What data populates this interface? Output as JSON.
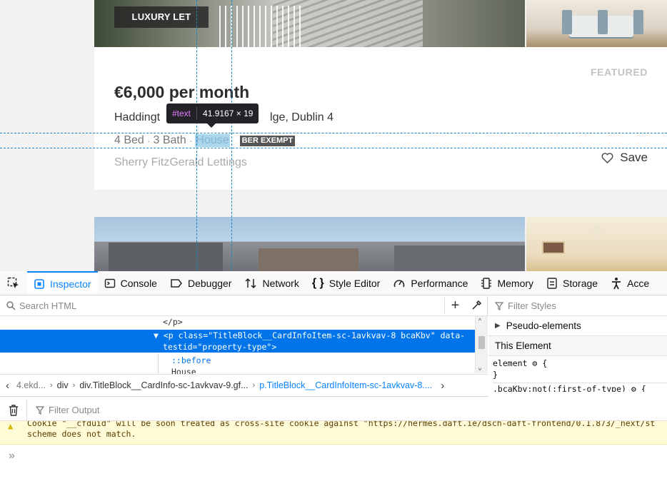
{
  "listing": {
    "badge": "LUXURY LET",
    "featured": "FEATURED",
    "price": "€6,000 per month",
    "address_left": "Haddingt",
    "address_right": "lge, Dublin 4",
    "beds": "4 Bed",
    "baths": "3 Bath",
    "type": "House",
    "ber": "BER EXEMPT",
    "agent": "Sherry FitzGerald Lettings",
    "save_label": "Save"
  },
  "inspector_tooltip": {
    "node": "#text",
    "size": "41.9167 × 19"
  },
  "devtools": {
    "tabs": [
      {
        "label": "Inspector",
        "icon": "inspector-icon",
        "active": true
      },
      {
        "label": "Console",
        "icon": "console-icon"
      },
      {
        "label": "Debugger",
        "icon": "debugger-icon"
      },
      {
        "label": "Network",
        "icon": "network-icon"
      },
      {
        "label": "Style Editor",
        "icon": "style-editor-icon"
      },
      {
        "label": "Performance",
        "icon": "performance-icon"
      },
      {
        "label": "Memory",
        "icon": "memory-icon"
      },
      {
        "label": "Storage",
        "icon": "storage-icon"
      },
      {
        "label": "Acce",
        "icon": "accessibility-icon"
      }
    ],
    "search_placeholder": "Search HTML",
    "markup": {
      "line1": "</p>",
      "line2": "▼ <p class=\"TitleBlock__CardInfoItem-sc-1avkvav-8 bcaKbv\" data-",
      "line3": "testid=\"property-type\">",
      "line4": "::before",
      "line5": "House"
    },
    "rules": {
      "filter_placeholder": "Filter Styles",
      "pseudo": "Pseudo-elements",
      "this_element": "This Element",
      "rule1": "element ⚙ {",
      "rule1_close": "}",
      "rule2": ".bcaKbv:not(:first-of-type) ⚙ {"
    },
    "breadcrumbs": [
      "4.ekd...",
      "div",
      "div.TitleBlock__CardInfo-sc-1avkvav-9.gf...",
      "p.TitleBlock__CardInfoItem-sc-1avkvav-8...."
    ],
    "console": {
      "filter_placeholder": "Filter Output",
      "warning_line1": "Cookie \"__cfduid\" will be soon treated as cross-site cookie against \"https://hermes.daft.ie/dsch-daft-frontend/0.1.873/_next/st",
      "warning_line2": "scheme does not match.",
      "prompt": "»"
    }
  },
  "colors": {
    "accent": "#0a84ff",
    "selection": "#0074e8",
    "highlight": "#aad6ee"
  }
}
